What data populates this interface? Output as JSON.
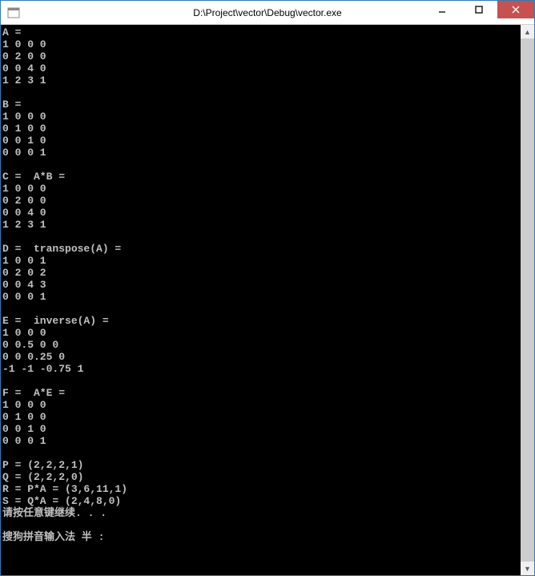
{
  "window": {
    "title": "D:\\Project\\vector\\Debug\\vector.exe"
  },
  "console": {
    "lines": [
      "A =",
      "1 0 0 0",
      "0 2 0 0",
      "0 0 4 0",
      "1 2 3 1",
      "",
      "B =",
      "1 0 0 0",
      "0 1 0 0",
      "0 0 1 0",
      "0 0 0 1",
      "",
      "C =  A*B =",
      "1 0 0 0",
      "0 2 0 0",
      "0 0 4 0",
      "1 2 3 1",
      "",
      "D =  transpose(A) =",
      "1 0 0 1",
      "0 2 0 2",
      "0 0 4 3",
      "0 0 0 1",
      "",
      "E =  inverse(A) =",
      "1 0 0 0",
      "0 0.5 0 0",
      "0 0 0.25 0",
      "-1 -1 -0.75 1",
      "",
      "F =  A*E =",
      "1 0 0 0",
      "0 1 0 0",
      "0 0 1 0",
      "0 0 0 1",
      "",
      "P = (2,2,2,1)",
      "Q = (2,2,2,0)",
      "R = P*A = (3,6,11,1)",
      "S = Q*A = (2,4,8,0)",
      "请按任意键继续. . ."
    ],
    "ime_status": "搜狗拼音输入法 半 :"
  }
}
